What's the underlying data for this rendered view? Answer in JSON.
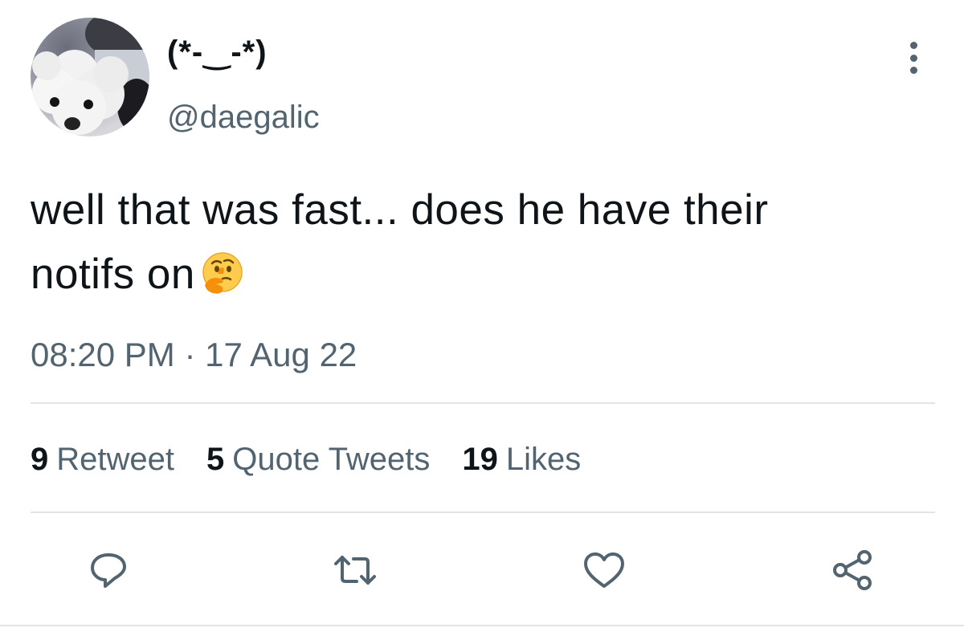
{
  "tweet": {
    "display_name": "(*-‿-*)",
    "handle": "@daegalic",
    "text_line1": "well that was fast... does he have their",
    "text_line2": "notifs on",
    "emoji": "thinking-face-emoji",
    "timestamp": "08:20 PM · 17 Aug 22"
  },
  "stats": {
    "retweets_count": "9",
    "retweets_label": "Retweet",
    "quotes_count": "5",
    "quotes_label": "Quote Tweets",
    "likes_count": "19",
    "likes_label": "Likes"
  },
  "actions": {
    "reply_icon": "reply-icon",
    "retweet_icon": "retweet-icon",
    "like_icon": "heart-icon",
    "share_icon": "share-icon"
  },
  "colors": {
    "text_primary": "#0f1419",
    "text_secondary": "#536471",
    "divider": "#e1e5e8",
    "icon": "#536471"
  }
}
